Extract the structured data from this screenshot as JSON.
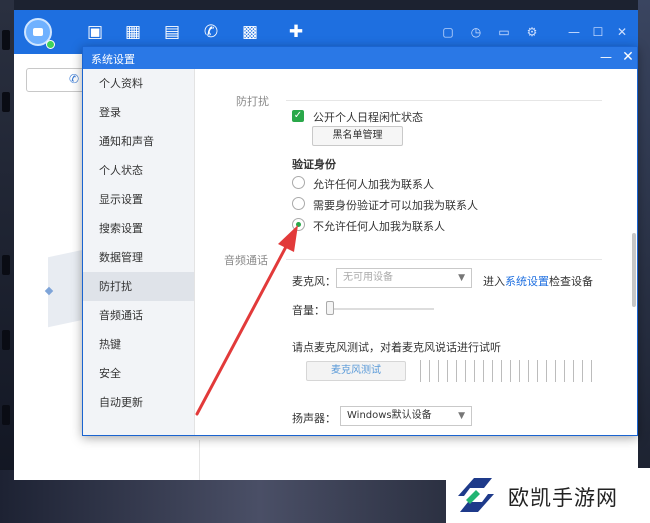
{
  "dialog": {
    "title": "系统设置",
    "min_icon": "minimize-icon",
    "close_icon": "close-icon"
  },
  "nav": {
    "items": [
      "个人资料",
      "登录",
      "通知和声音",
      "个人状态",
      "显示设置",
      "搜索设置",
      "数据管理",
      "防打扰",
      "音频通话",
      "热键",
      "安全",
      "自动更新"
    ],
    "active": "防打扰"
  },
  "dnd": {
    "section_title": "防打扰",
    "public_schedule_label": "公开个人日程闲忙状态",
    "public_schedule_checked": true,
    "blacklist_button": "黑名单管理",
    "verify_heading": "验证身份",
    "options": [
      "允许任何人加我为联系人",
      "需要身份验证才可以加我为联系人",
      "不允许任何人加我为联系人"
    ],
    "selected_option": "不允许任何人加我为联系人"
  },
  "audio": {
    "section_title": "音频通话",
    "mic_label": "麦克风：",
    "mic_value": "无可用设备",
    "mic_hint_prefix": "进入",
    "mic_hint_link": "系统设置",
    "mic_hint_suffix": "检查设备",
    "volume_label": "音量：",
    "test_prompt": "请点麦克风测试，对着麦克风说话进行试听",
    "test_button": "麦克风测试",
    "speaker_label": "扬声器：",
    "speaker_value": "Windows默认设备"
  },
  "watermark": {
    "text": "欧凯手游网"
  },
  "colors": {
    "brand_blue": "#1e6fe0",
    "check_green": "#2aa84a",
    "annotation_red": "#e23a3a"
  }
}
